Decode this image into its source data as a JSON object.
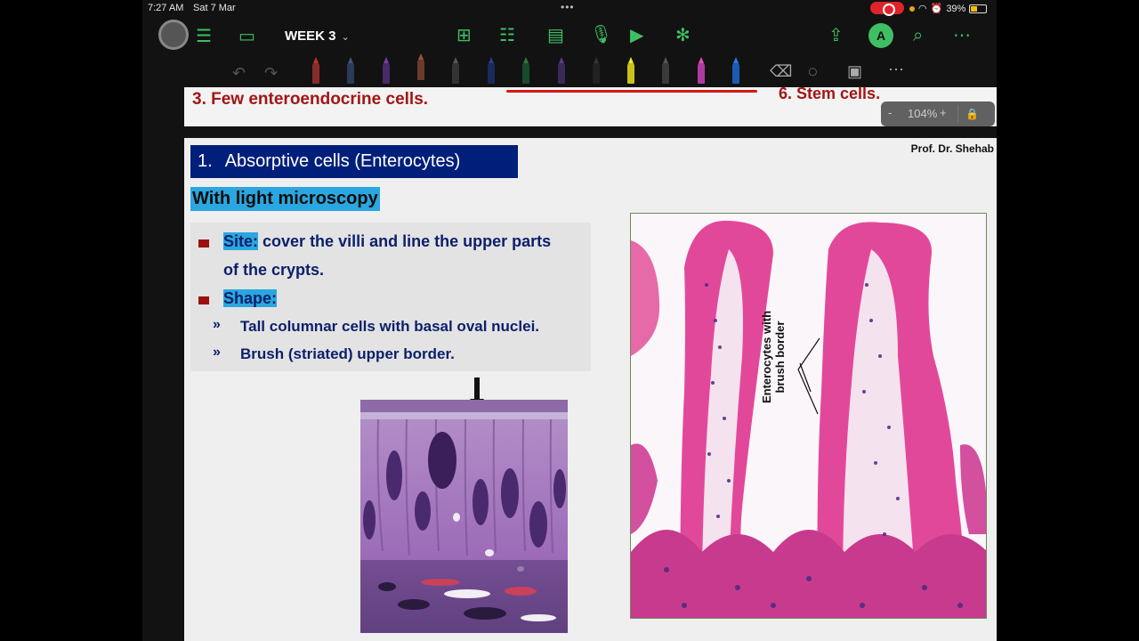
{
  "status_bar": {
    "time": "7:27 AM",
    "date": "Sat 7 Mar",
    "battery": "39%"
  },
  "toolbar": {
    "title": "WEEK 3",
    "accent_color": "#3fbf63",
    "icons": [
      "sidebar-list-icon",
      "panel-icon",
      "add-page-icon",
      "checklist-icon",
      "document-icon",
      "microphone-icon",
      "play-icon",
      "ai-icon",
      "share-icon",
      "pen-mode-icon",
      "search-icon",
      "more-icon"
    ]
  },
  "pens": {
    "tools": [
      "undo-icon",
      "redo-icon",
      "pen-red",
      "pen-blue",
      "pen-purple",
      "pen-brown",
      "pen-gray",
      "pen-navy",
      "pen-green",
      "pen-violet",
      "pen-dark",
      "highlighter-yellow",
      "pencil-gray",
      "highlighter-pink",
      "highlighter-blue",
      "eraser-icon",
      "lasso-icon",
      "image-icon",
      "more-icon"
    ]
  },
  "document": {
    "previous_page": {
      "item3": "3.  Few enteroendocrine cells.",
      "item6": "6. Stem cells."
    },
    "zoom": {
      "minus": "-",
      "value": "104%",
      "plus": "+"
    },
    "slide": {
      "author": "Prof. Dr. Shehab",
      "heading_num": "1.",
      "heading_text": "Absorptive cells (Enterocytes)",
      "subheading": "With light microscopy",
      "site_label": "Site:",
      "site_text_1": "cover the villi and line the upper parts",
      "site_text_2": "of the crypts.",
      "shape_label": "Shape:",
      "shape_items": [
        "Tall columnar cells with basal oval nuclei.",
        "Brush (striated) upper border."
      ],
      "sub_bullet": "»",
      "micro_label_1": "Enterocytes with",
      "micro_label_2": "brush border"
    }
  }
}
